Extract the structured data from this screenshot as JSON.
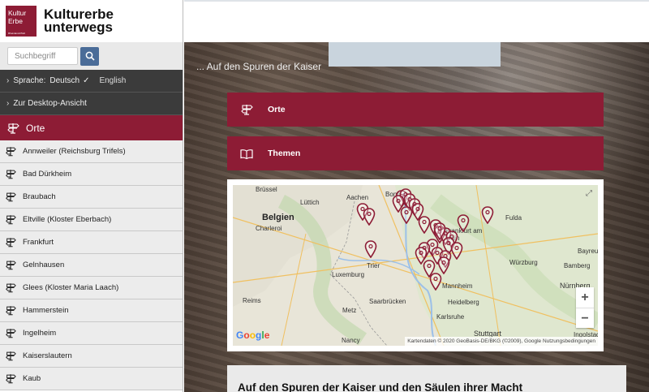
{
  "brand": {
    "logo_line1": "Kultur",
    "logo_line2": "Erbe",
    "logo_sub": "Rheinland-Pfalz",
    "title_line1": "Kulturerbe",
    "title_line2": "unterwegs"
  },
  "search": {
    "placeholder": "Suchbegriff",
    "value": "",
    "icon": "search-icon"
  },
  "language": {
    "label": "Sprache:",
    "current": "Deutsch",
    "check": "✓",
    "other": "English"
  },
  "desktop_view": {
    "label": "Zur Desktop-Ansicht"
  },
  "sidebar": {
    "section_label": "Orte",
    "places": [
      "Annweiler (Reichsburg Trifels)",
      "Bad Dürkheim",
      "Braubach",
      "Eltville (Kloster Eberbach)",
      "Frankfurt",
      "Gelnhausen",
      "Glees (Kloster Maria Laach)",
      "Hammerstein",
      "Ingelheim",
      "Kaiserslautern",
      "Kaub"
    ]
  },
  "main": {
    "tagline": "... Auf den Spuren der Kaiser",
    "nav_cards": [
      {
        "label": "Orte",
        "icon": "signpost-icon"
      },
      {
        "label": "Themen",
        "icon": "book-icon"
      }
    ],
    "map": {
      "labels": [
        "Brüssel",
        "Lüttich",
        "Aachen",
        "Bonn",
        "Belgien",
        "Charleroi",
        "Luxemburg",
        "Trier",
        "Frankfurt am Main",
        "Fulda",
        "Würzburg",
        "Bamberg",
        "Bayreuth",
        "Nürnberg",
        "Mannheim",
        "Heidelberg",
        "Saarbrücken",
        "Metz",
        "Reims",
        "Nancy",
        "Karlsruhe",
        "Stuttgart",
        "Ingolstadt"
      ],
      "zoom_in": "+",
      "zoom_out": "−",
      "fullscreen": "⤢",
      "google": "Google",
      "attribution": "Kartendaten © 2020 GeoBasis-DE/BKG (©2009), Google   Nutzungsbedingungen"
    },
    "article_title": "Auf den Spuren der Kaiser und den Säulen ihrer Macht"
  },
  "colors": {
    "accent": "#8d1c35",
    "dark_row": "#3b3b3b",
    "search_button": "#4a6c98"
  }
}
